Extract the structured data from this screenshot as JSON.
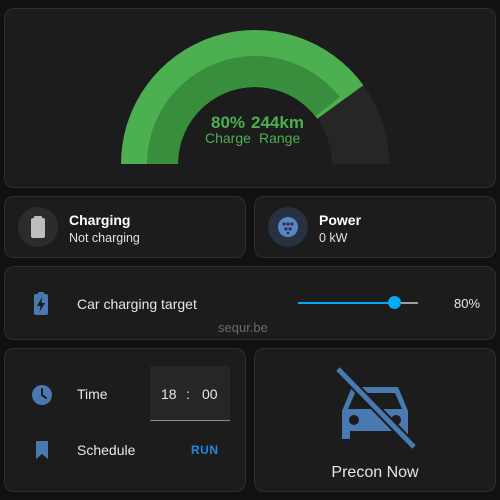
{
  "colors": {
    "charge": "#4caf50",
    "charge_inner": "#388e3c",
    "gauge_bg": "#262626",
    "icon_blue": "#4a78b0",
    "slider": "#03a9f4"
  },
  "gauge": {
    "charge_percent": 80,
    "charge_value": "80%",
    "range_value": "244km",
    "charge_label": "Charge",
    "range_label": "Range"
  },
  "charging_tile": {
    "icon": "battery-icon",
    "title": "Charging",
    "subtitle": "Not charging"
  },
  "power_tile": {
    "icon": "ev-plug-icon",
    "title": "Power",
    "subtitle": "0 kW"
  },
  "charging_target": {
    "icon": "battery-charging-icon",
    "label": "Car charging target",
    "value_percent": 80,
    "value_text": "80%"
  },
  "watermark": "sequr.be",
  "schedule": {
    "time_label": "Time",
    "hour": "18",
    "separator": ":",
    "minute": "00",
    "schedule_label": "Schedule",
    "run_label": "RUN"
  },
  "precon": {
    "icon": "car-off-icon",
    "label": "Precon Now"
  }
}
